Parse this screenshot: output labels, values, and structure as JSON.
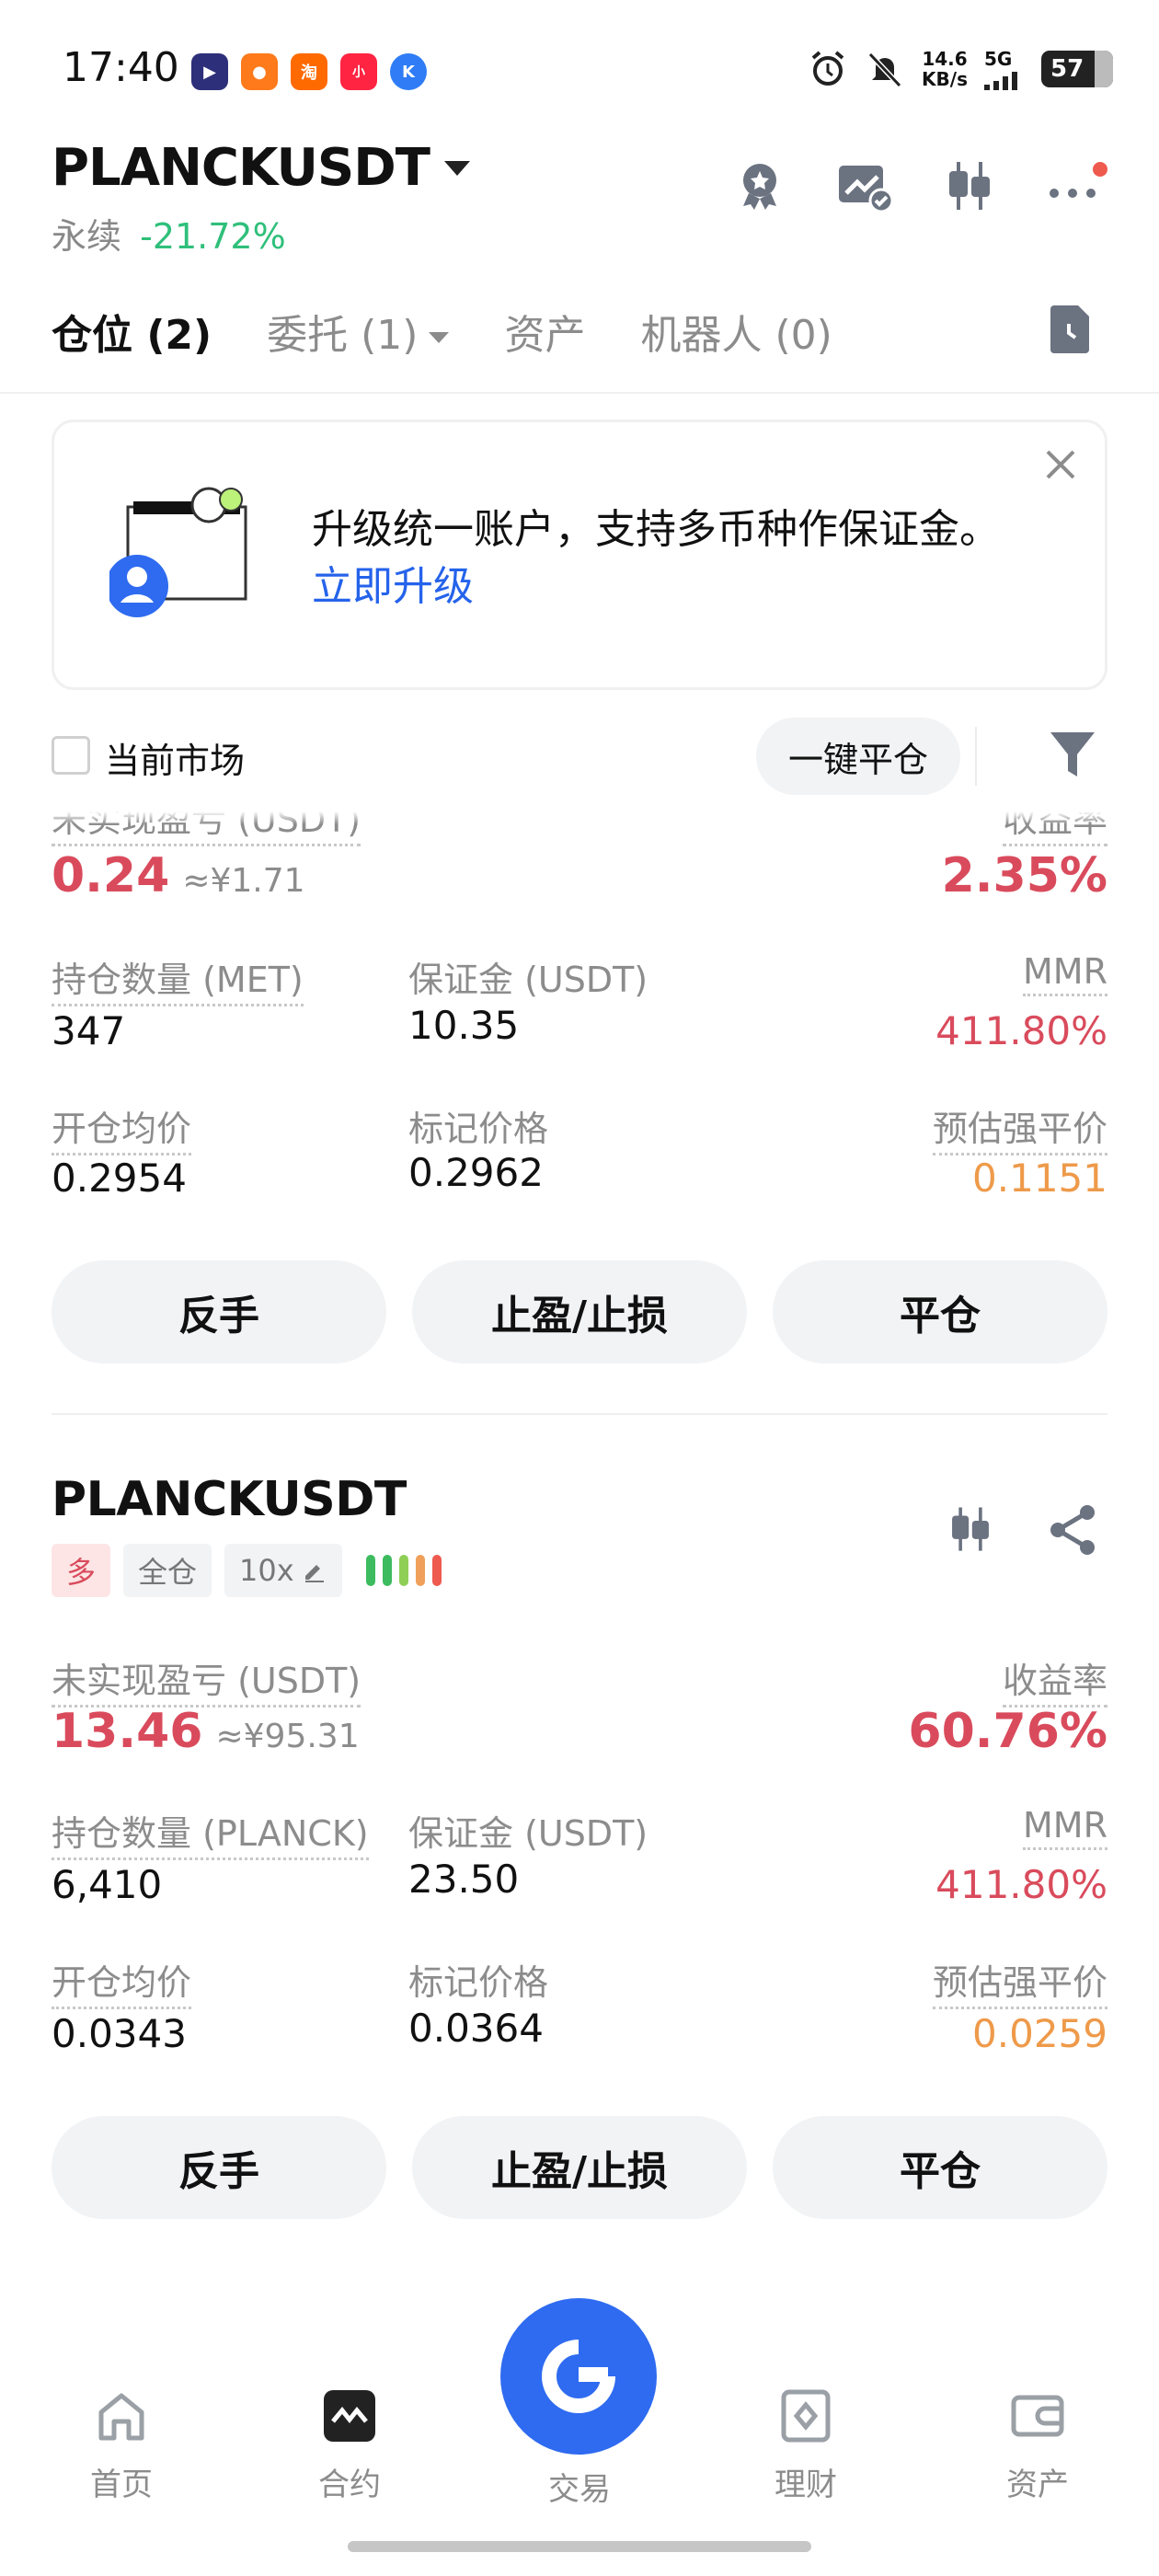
{
  "status_bar": {
    "time": "17:40",
    "app_icons": [
      {
        "name": "play-app-icon",
        "color": "#2d2f7a",
        "glyph": "▶"
      },
      {
        "name": "kuaishou-app-icon",
        "color": "#ff7a1a",
        "glyph": "●"
      },
      {
        "name": "taobao-app-icon",
        "color": "#ff6a00",
        "glyph": "淘"
      },
      {
        "name": "xiaohongshu-app-icon",
        "color": "#ff2442",
        "glyph": "小"
      },
      {
        "name": "k-app-icon",
        "color": "#2f7cf6",
        "glyph": "K"
      }
    ],
    "net_speed_value": "14.6",
    "net_speed_unit": "KB/s",
    "net_type": "5G",
    "battery": "57"
  },
  "header": {
    "pair": "PLANCKUSDT",
    "contract_type": "永续",
    "change": "-21.72%"
  },
  "tabs": [
    {
      "label": "仓位 (2)",
      "active": true
    },
    {
      "label": "委托 (1)",
      "dropdown": true
    },
    {
      "label": "资产"
    },
    {
      "label": "机器人 (0)"
    }
  ],
  "banner": {
    "text": "升级统一账户，支持多币种作保证金。",
    "link": "立即升级"
  },
  "filter": {
    "current_market": "当前市场",
    "close_all": "一键平仓"
  },
  "positions": [
    {
      "pnl_label": "未实现盈亏 (USDT)",
      "pnl": "0.24",
      "pnl_cny": "≈¥1.71",
      "rate_label": "收益率",
      "rate": "2.35%",
      "qty_label": "持仓数量 (MET)",
      "qty": "347",
      "margin_label": "保证金 (USDT)",
      "margin": "10.35",
      "mmr_label": "MMR",
      "mmr": "411.80%",
      "entry_label": "开仓均价",
      "entry": "0.2954",
      "mark_label": "标记价格",
      "mark": "0.2962",
      "liq_label": "预估强平价",
      "liq": "0.1151",
      "btn_reverse": "反手",
      "btn_tpsl": "止盈/止损",
      "btn_close": "平仓"
    },
    {
      "title": "PLANCKUSDT",
      "tag_side": "多",
      "tag_mode": "全仓",
      "tag_leverage": "10x",
      "pnl_label": "未实现盈亏 (USDT)",
      "pnl": "13.46",
      "pnl_cny": "≈¥95.31",
      "rate_label": "收益率",
      "rate": "60.76%",
      "qty_label": "持仓数量 (PLANCK)",
      "qty": "6,410",
      "margin_label": "保证金 (USDT)",
      "margin": "23.50",
      "mmr_label": "MMR",
      "mmr": "411.80%",
      "entry_label": "开仓均价",
      "entry": "0.0343",
      "mark_label": "标记价格",
      "mark": "0.0364",
      "liq_label": "预估强平价",
      "liq": "0.0259",
      "btn_reverse": "反手",
      "btn_tpsl": "止盈/止损",
      "btn_close": "平仓"
    }
  ],
  "colors": {
    "profit_red": "#d94b5c",
    "change_green": "#2fbf7a",
    "liq_orange": "#ee9a4a",
    "accent_blue": "#2f6bf0"
  },
  "bottom_nav": [
    {
      "label": "首页",
      "icon": "home-icon"
    },
    {
      "label": "合约",
      "icon": "futures-icon",
      "active": true
    },
    {
      "label": "交易",
      "icon": "trade-icon"
    },
    {
      "label": "理财",
      "icon": "earn-icon"
    },
    {
      "label": "资产",
      "icon": "wallet-icon"
    }
  ]
}
